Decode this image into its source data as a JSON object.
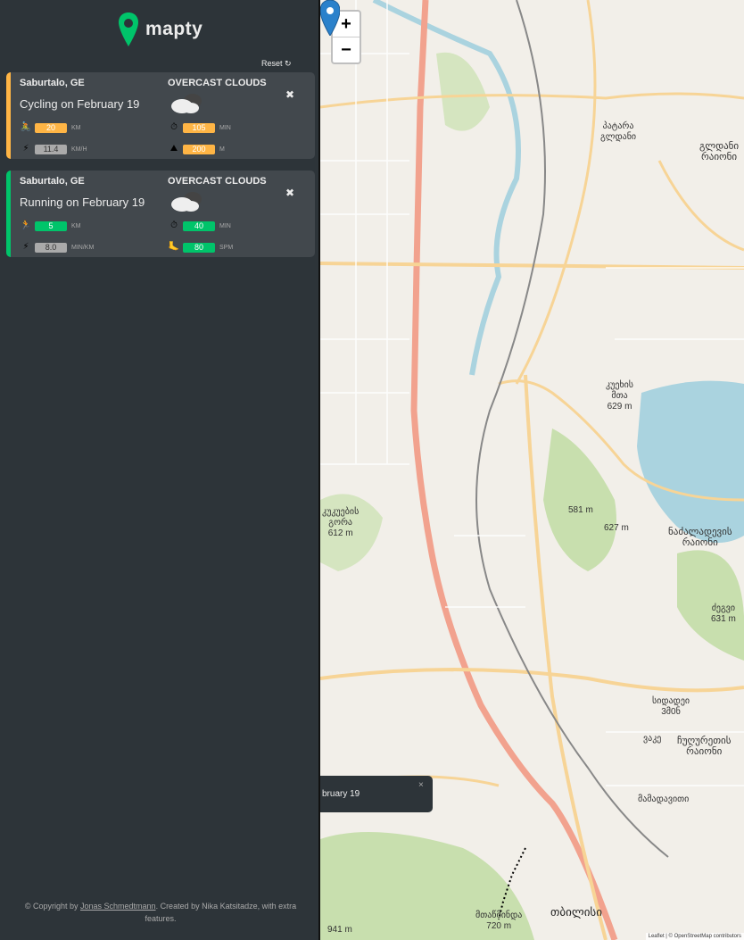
{
  "sidebar": {
    "logo_text": "mapty",
    "reset_label": "Reset ↻",
    "workouts": [
      {
        "type": "cycling",
        "location": "Saburtalo, GE",
        "title": "Cycling on February 19",
        "weather": "OVERCAST CLOUDS",
        "distance": "20",
        "distance_unit": "KM",
        "duration": "105",
        "duration_unit": "MIN",
        "speed": "11.4",
        "speed_unit": "KM/H",
        "elevation": "200",
        "elevation_unit": "M"
      },
      {
        "type": "running",
        "location": "Saburtalo, GE",
        "title": "Running on February 19",
        "weather": "OVERCAST CLOUDS",
        "distance": "5",
        "distance_unit": "KM",
        "duration": "40",
        "duration_unit": "MIN",
        "pace": "8.0",
        "pace_unit": "MIN/KM",
        "cadence": "80",
        "cadence_unit": "SPM"
      }
    ],
    "close_symbol": "✖",
    "copyright_prefix": "© Copyright by ",
    "copyright_link": "Jonas Schmedtmann",
    "copyright_suffix": ". Created by Nika Katsitadze, with extra features."
  },
  "map": {
    "zoom_in": "+",
    "zoom_out": "−",
    "popup_text": "bruary 19",
    "popup_close": "×",
    "labels": {
      "lake_hill": "კუეხის\nმთა\n629 m",
      "nadzaladevi": "ნაძალადევის\nრაიონი",
      "gldani": "გლდანი\nრაიონი",
      "chughureti": "ჩუღურეთის\nრაიონი",
      "tbilisi": "თბილისი",
      "mtatsminda": "მთაწმინდა\n720 m",
      "hill_612": "კუკუების\nგორა\n612 m",
      "elev_581": "581 m",
      "elev_627": "627 m",
      "elev_631": "ძეგვი\n631 m",
      "elev_941": "941 m",
      "district_patara": "პატარა\nგლდანი",
      "district_vake": "ვაკე",
      "mamadaviti": "მამადავითი",
      "avchala": "სიდადეი\n3მ0ნ"
    },
    "attribution": "Leaflet | © OpenStreetMap contributors"
  }
}
